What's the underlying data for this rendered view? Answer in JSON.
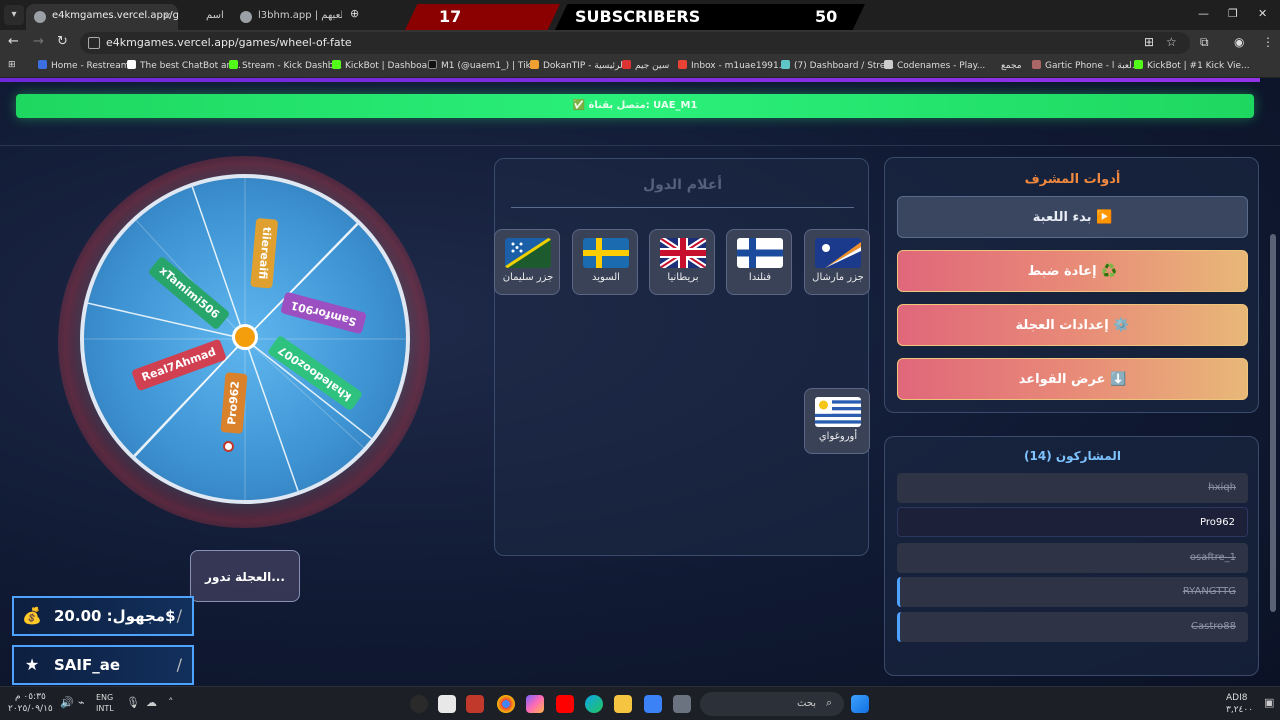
{
  "browser": {
    "tabs": [
      {
        "title": "e4kmgames.vercel.app/games/"
      },
      {
        "title": "اسم"
      },
      {
        "title": "l3bhm.app | لعبهم"
      }
    ],
    "url": "e4kmgames.vercel.app/games/wheel-of-fate",
    "bookmarks": [
      "Home - Restream",
      "The best ChatBot an...",
      "Stream - Kick Dashb...",
      "KickBot | Dashboard",
      "M1 (@uaem1_) | Tik...",
      "DokanTIP - الرئيسية",
      "سين جيم",
      "Inbox - m1uae1991...",
      "(7) Dashboard / Stre...",
      "Codenames - Play...",
      "مجمع",
      "Gartic Phone - لعبة ا...",
      "KickBot | #1 Kick Vie..."
    ]
  },
  "subscribers_overlay": {
    "left_count": "17",
    "label": "SUBSCRIBERS",
    "right_count": "50"
  },
  "connection": {
    "text": "✅ متصل بقناة: UAE_M1"
  },
  "wheel": {
    "segments": [
      {
        "label": "tiiereaifi",
        "color": "#e0a030"
      },
      {
        "label": "Samfor901",
        "color": "#9b4fc0"
      },
      {
        "label": "khaledooz007",
        "color": "#2ec27e"
      },
      {
        "label": "Pro962",
        "color": "#d9822b"
      },
      {
        "label": "Real7Ahmad",
        "color": "#d04050"
      },
      {
        "label": "xTamimi506",
        "color": "#27a56b"
      }
    ]
  },
  "spin_status": "العجلة تدور...",
  "stats": {
    "money": "مجهول: 20.00$",
    "user": "SAIF_ae"
  },
  "flags": {
    "title": "أعلام الدول",
    "items": [
      {
        "name": "جزر مارشال",
        "icon": "marshall-islands-flag"
      },
      {
        "name": "فنلندا",
        "icon": "finland-flag"
      },
      {
        "name": "بريطانيا",
        "icon": "uk-flag"
      },
      {
        "name": "السويد",
        "icon": "sweden-flag"
      },
      {
        "name": "جزر سليمان",
        "icon": "solomon-islands-flag"
      },
      {
        "name": "أوروغواي",
        "icon": "uruguay-flag"
      }
    ]
  },
  "admin": {
    "title": "أدوات المشرف",
    "buttons": [
      {
        "label": "بدء اللعبة ▶️"
      },
      {
        "label": "إعادة ضبط ♻️"
      },
      {
        "label": "إعدادات العجلة ⚙️"
      },
      {
        "label": "عرض القواعد ⬇️"
      }
    ]
  },
  "participants": {
    "title": "المشاركون (14)",
    "items": [
      {
        "name": "hxiqh",
        "state": "eliminated"
      },
      {
        "name": "Pro962",
        "state": "active"
      },
      {
        "name": "osaftre_1",
        "state": "eliminated"
      },
      {
        "name": "RYANGTTG",
        "state": "eliminated"
      },
      {
        "name": "Castro88",
        "state": "eliminated"
      }
    ]
  },
  "taskbar": {
    "time": "٠٥:٣٥ م",
    "date": "٢٠٢٥/٠٩/١٥",
    "lang": "ENG",
    "layout": "INTL",
    "search": "بحث",
    "right_top": "ADI8",
    "right_bottom": "٣,٢٤٠٠"
  }
}
